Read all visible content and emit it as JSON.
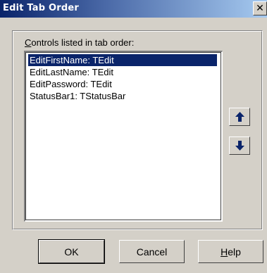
{
  "window": {
    "title": "Edit Tab Order",
    "close_glyph": "✕"
  },
  "list": {
    "label_accel": "C",
    "label_rest": "ontrols listed in tab order:",
    "items": [
      {
        "label": "EditFirstName: TEdit",
        "selected": true
      },
      {
        "label": "EditLastName: TEdit",
        "selected": false
      },
      {
        "label": "EditPassword: TEdit",
        "selected": false
      },
      {
        "label": "StatusBar1: TStatusBar",
        "selected": false
      }
    ]
  },
  "buttons": {
    "move_up_icon": "arrow-up-icon",
    "move_down_icon": "arrow-down-icon",
    "ok_label": "OK",
    "cancel_label": "Cancel",
    "help_accel": "H",
    "help_rest": "elp"
  },
  "colors": {
    "selection": "#0a246a",
    "arrow": "#0a246a",
    "face": "#d4d0c8"
  }
}
